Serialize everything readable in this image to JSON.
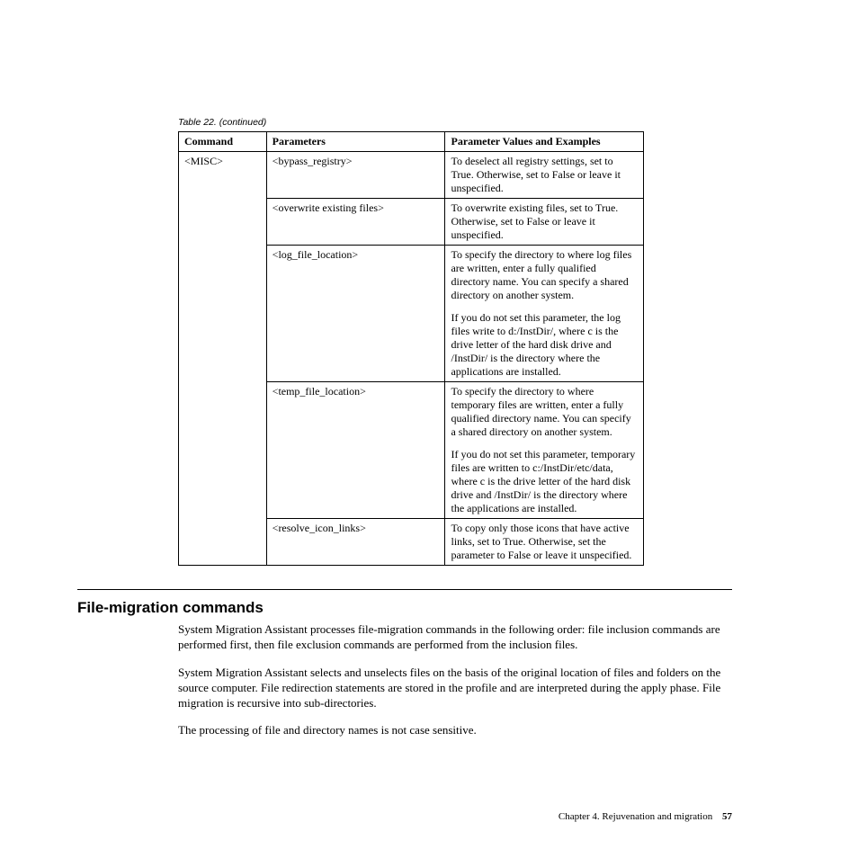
{
  "caption": "Table 22.  (continued)",
  "headers": {
    "command": "Command",
    "parameters": "Parameters",
    "values": "Parameter Values and Examples"
  },
  "command": "<MISC>",
  "rows": [
    {
      "param": "<bypass_registry>",
      "value_p1": "To deselect all registry settings, set to True. Otherwise, set to False or leave it unspecified."
    },
    {
      "param": "<overwrite existing files>",
      "value_p1": "To overwrite existing files, set to True. Otherwise, set to False or leave it unspecified."
    },
    {
      "param": "<log_file_location>",
      "value_p1": "To specify the directory to where log files are written, enter a fully qualified directory name. You can specify a shared directory on another system.",
      "value_p2": "If you do not set this parameter, the log files write to d:/InstDir/, where c is the drive letter of the hard disk drive and /InstDir/ is the directory where the applications are installed."
    },
    {
      "param": "<temp_file_location>",
      "value_p1": "To specify the directory to where temporary files are written, enter a fully qualified directory name. You can specify a shared directory on another system.",
      "value_p2": "If you do not set this parameter, temporary files are written to c:/InstDir/etc/data, where c is the drive letter of the hard disk drive and /InstDir/ is the directory where the applications are installed."
    },
    {
      "param": "<resolve_icon_links>",
      "value_p1": "To copy only those icons that have active links, set to True. Otherwise, set the parameter to False or leave it unspecified."
    }
  ],
  "section_title": "File-migration commands",
  "body": {
    "p1": "System Migration Assistant processes file-migration commands in the following order: file inclusion commands are performed first, then file exclusion commands are performed from the inclusion files.",
    "p2": "System Migration Assistant selects and unselects files on the basis of the original location of files and folders on the source computer. File redirection statements are stored in the profile and are interpreted during the apply phase. File migration is recursive into sub-directories.",
    "p3": "The processing of file and directory names is not case sensitive."
  },
  "footer": {
    "chapter": "Chapter 4. Rejuvenation and migration",
    "page": "57"
  }
}
